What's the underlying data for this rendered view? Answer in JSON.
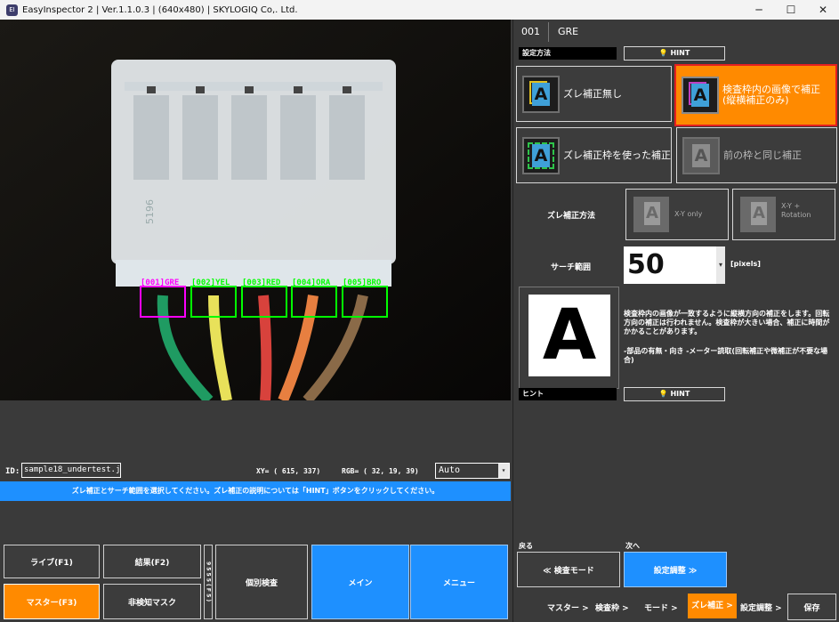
{
  "titlebar": {
    "title": "EasyInspector 2 | Ver.1.1.0.3 | (640x480) | SKYLOGIQ Co,. Ltd.",
    "minimize": "─",
    "maximize": "☐",
    "close": "✕"
  },
  "camera": {
    "boxes": [
      {
        "label": "[001]GRE",
        "color": "#ff00ff"
      },
      {
        "label": "[002]YEL",
        "color": "#00ff00"
      },
      {
        "label": "[003]RED",
        "color": "#00ff00"
      },
      {
        "label": "[004]ORA",
        "color": "#00ff00"
      },
      {
        "label": "[005]BRO",
        "color": "#00ff00"
      }
    ],
    "connector_text": "5196"
  },
  "status": {
    "id_label": "ID:",
    "id_value": "sample18_undertest.j",
    "xy_text": "XY= ( 615,  337)",
    "rgb_text": "RGB= ( 32,  19,  39)",
    "mode": "Auto"
  },
  "message": "ズレ補正とサーチ範囲を選択してください。ズレ補正の説明については「HINT」ボタンをクリックしてください。",
  "bottom": {
    "live": "ライブ(F1)",
    "result": "結果(F2)",
    "master": "マスター(F3)",
    "mask": "非検知マスク",
    "vertical": "9 5 5 5 ( F 5 )",
    "individual": "個別検査",
    "main": "メイン",
    "menu": "メニュー"
  },
  "right": {
    "header_id": "001",
    "header_name": "GRE",
    "setting_label": "設定方法",
    "hint": "HINT",
    "options": [
      {
        "label": "ズレ補正無し"
      },
      {
        "label": "検査枠内の画像で補正\n(縦横補正のみ)",
        "selected": true
      },
      {
        "label": "ズレ補正枠を使った補正"
      },
      {
        "label": "前の枠と同じ補正"
      }
    ],
    "method_label": "ズレ補正方法",
    "method_xy": "X-Y only",
    "method_rot": "X-Y + Rotation",
    "search_label": "サーチ範囲",
    "search_value": "50",
    "search_unit": "[pixels]",
    "desc1": "検査枠内の画像が一致するように縦横方向の補正をします。回転方向の補正は行われません。検査枠が大きい場合、補正に時間がかかることがあります。",
    "desc2": "-部品の有無・向き -メーター読取(回転補正や微補正が不要な場合)",
    "hint_label": "ヒント",
    "back_label": "戻る",
    "next_label": "次へ",
    "back_btn": "≪ 検査モード",
    "next_btn": "設定調整 ≫",
    "breadcrumb": [
      "マスター >",
      "検査枠 >",
      "モード >",
      "ズレ補正 >",
      "設定調整 >"
    ],
    "save": "保存"
  },
  "colors": {
    "accent_orange": "#ff8a00",
    "accent_blue": "#1e90ff",
    "selected_border": "#e52020"
  }
}
